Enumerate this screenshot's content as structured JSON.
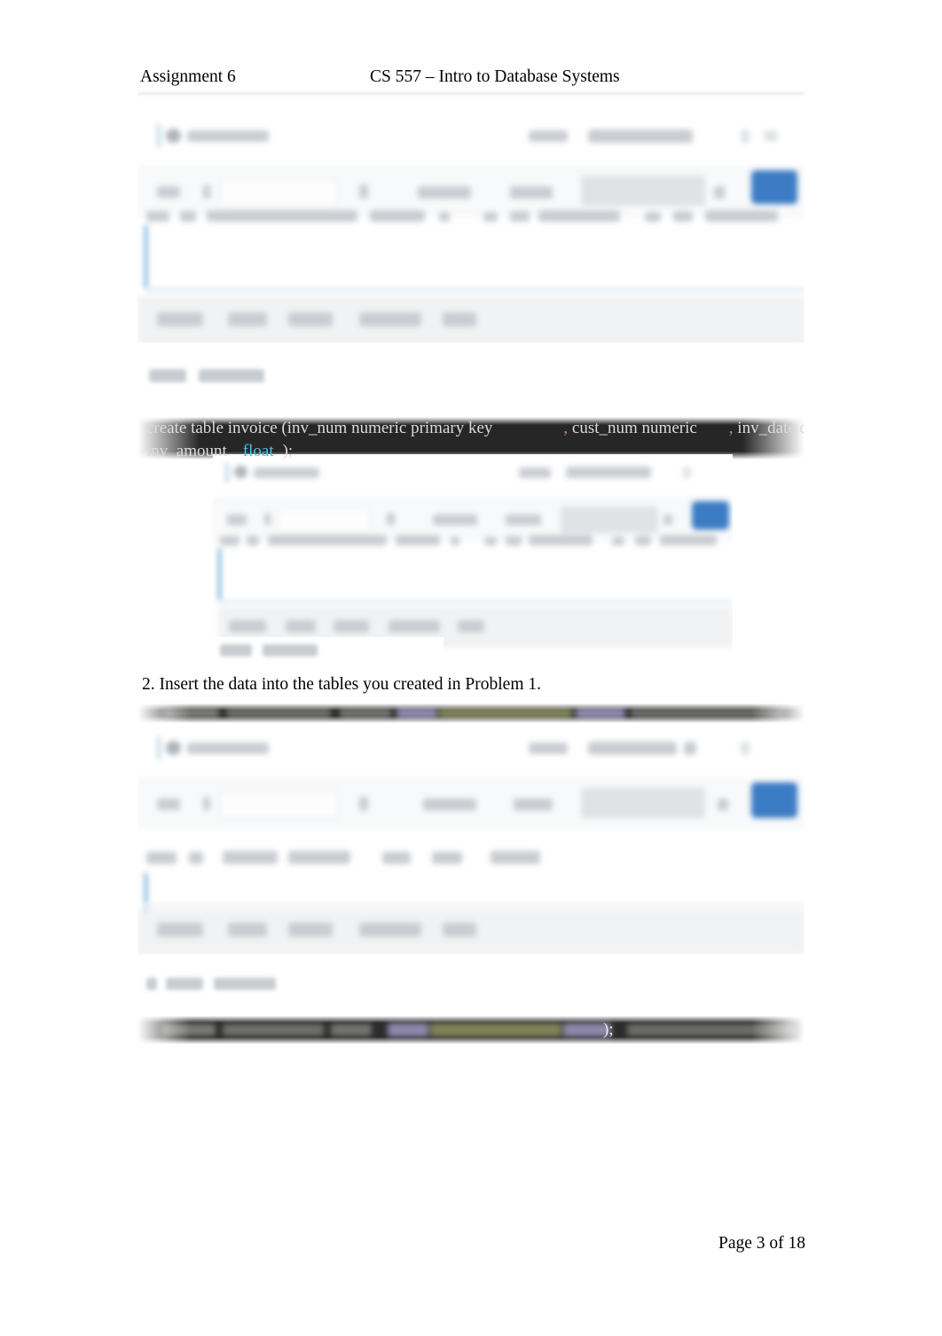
{
  "document": {
    "header": {
      "assignment_label": "Assignment 6",
      "course_title": "CS 557 – Intro to Database Systems"
    },
    "footer": {
      "page_label": "Page 3 of 18"
    }
  },
  "body": {
    "problem2_text": "2. Insert the data into the tables you created in Problem 1."
  },
  "code_blocks": {
    "create_invoice": {
      "line1_a": "create table invoice (inv_num numeric primary key",
      "line1_comma1": ",",
      "line1_b": " cust_num numeric",
      "line1_comma2": ",",
      "line1_c": " inv_date date",
      "line1_comma3": ",",
      "line2_a": "inv_amount",
      "line2_type": "float",
      "line2_end": ");"
    },
    "insert_block_top": {
      "visible_text": ""
    },
    "insert_block_bottom": {
      "visible_text": ");"
    }
  },
  "screenshots": {
    "shot1": {
      "name": "sql-console-screenshot-1",
      "accent_color": "#3b7cc4",
      "tab_count": 5,
      "redacted": true
    },
    "shot2": {
      "name": "sql-console-screenshot-2",
      "accent_color": "#3b7cc4",
      "tab_count": 5,
      "redacted": true
    },
    "shot3": {
      "name": "sql-console-screenshot-3",
      "accent_color": "#3b7cc4",
      "tab_count": 5,
      "redacted": true
    }
  },
  "colors": {
    "accent_blue": "#3b7cc4",
    "code_background": "#262626",
    "code_keyword": "#4fc1e9",
    "code_punct": "#c98a6b",
    "page_background": "#ffffff"
  }
}
